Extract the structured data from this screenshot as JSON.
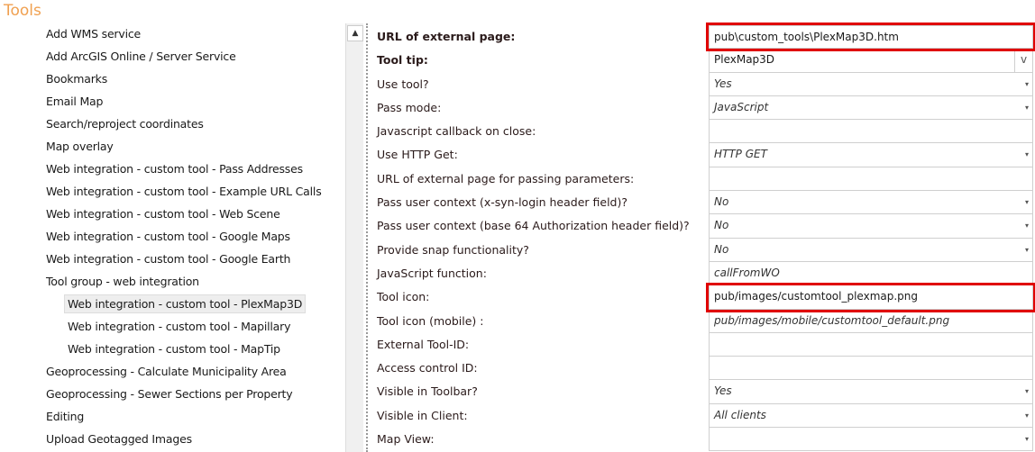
{
  "title": "Tools",
  "tools": [
    {
      "label": "Add WMS service",
      "level": 0
    },
    {
      "label": "Add ArcGIS Online / Server Service",
      "level": 0
    },
    {
      "label": "Bookmarks",
      "level": 0
    },
    {
      "label": "Email Map",
      "level": 0
    },
    {
      "label": "Search/reproject coordinates",
      "level": 0
    },
    {
      "label": "Map overlay",
      "level": 0
    },
    {
      "label": "Web integration - custom tool - Pass Addresses",
      "level": 0
    },
    {
      "label": "Web integration - custom tool - Example URL Calls",
      "level": 0
    },
    {
      "label": "Web integration - custom tool - Web Scene",
      "level": 0
    },
    {
      "label": "Web integration - custom tool - Google Maps",
      "level": 0
    },
    {
      "label": "Web integration - custom tool - Google Earth",
      "level": 0
    },
    {
      "label": "Tool group - web integration",
      "level": 0
    },
    {
      "label": "Web integration - custom tool - PlexMap3D",
      "level": 1,
      "selected": true
    },
    {
      "label": "Web integration - custom tool - Mapillary",
      "level": 1
    },
    {
      "label": "Web integration - custom tool - MapTip",
      "level": 1
    },
    {
      "label": "Geoprocessing - Calculate Municipality Area",
      "level": 0
    },
    {
      "label": "Geoprocessing - Sewer Sections per Property",
      "level": 0
    },
    {
      "label": "Editing",
      "level": 0
    },
    {
      "label": "Upload Geotagged Images",
      "level": 0
    }
  ],
  "properties": [
    {
      "label": "URL of external page:",
      "value": "pub\\custom_tools\\PlexMap3D.htm",
      "bold": true,
      "highlight": true
    },
    {
      "label": "Tool tip:",
      "value": "PlexMap3D",
      "bold": true,
      "control": "v"
    },
    {
      "label": "Use tool?",
      "value": "Yes",
      "italic": true,
      "control": "dropdown"
    },
    {
      "label": "Pass mode:",
      "value": "JavaScript",
      "italic": true,
      "control": "dropdown"
    },
    {
      "label": "Javascript callback on close:",
      "value": ""
    },
    {
      "label": "Use HTTP Get:",
      "value": "HTTP GET",
      "italic": true,
      "control": "dropdown"
    },
    {
      "label": "URL of external page for passing parameters:",
      "value": ""
    },
    {
      "label": "Pass user context (x-syn-login header field)?",
      "value": "No",
      "italic": true,
      "control": "dropdown"
    },
    {
      "label": "Pass user context (base 64 Authorization header field)?",
      "value": "No",
      "italic": true,
      "control": "dropdown"
    },
    {
      "label": "Provide snap functionality?",
      "value": "No",
      "italic": true,
      "control": "dropdown"
    },
    {
      "label": "JavaScript function:",
      "value": "callFromWO",
      "italic": true
    },
    {
      "label": "Tool icon:",
      "value": "pub/images/customtool_plexmap.png",
      "highlight": true
    },
    {
      "label": "Tool icon (mobile) :",
      "value": "pub/images/mobile/customtool_default.png",
      "italic": true
    },
    {
      "label": "External Tool-ID:",
      "value": ""
    },
    {
      "label": "Access control ID:",
      "value": ""
    },
    {
      "label": "Visible in Toolbar?",
      "value": "Yes",
      "italic": true,
      "control": "dropdown"
    },
    {
      "label": "Visible in Client:",
      "value": "All clients",
      "italic": true,
      "control": "dropdown"
    },
    {
      "label": "Map View:",
      "value": "",
      "control": "dropdown"
    }
  ],
  "icons": {
    "scroll_up": "▲",
    "dropdown": "▾",
    "v": "v"
  }
}
